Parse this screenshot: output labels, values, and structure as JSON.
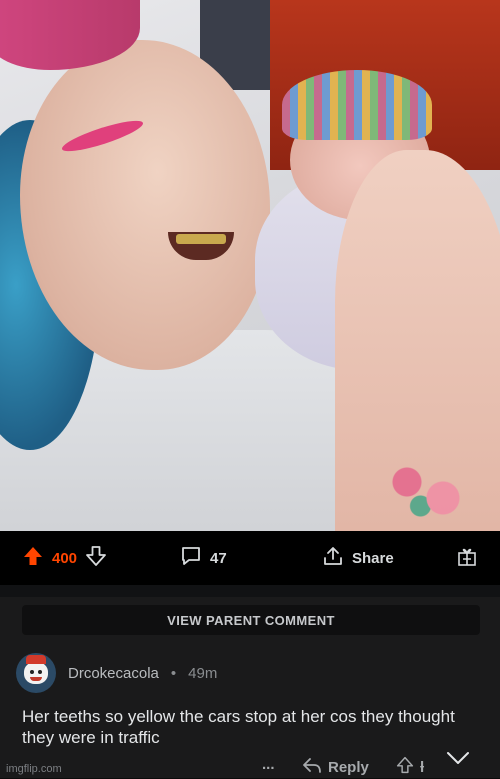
{
  "post": {
    "vote_count": "400",
    "comment_count": "47",
    "share_label": "Share"
  },
  "comment_section": {
    "view_parent_label": "VIEW PARENT COMMENT",
    "comment": {
      "username": "Drcokecacola",
      "separator": "•",
      "time_ago": "49m",
      "text": "Her teeths so yellow the cars stop at her cos they thought they were in traffic",
      "more_label": "...",
      "reply_label": "Reply",
      "vote_partial": "ƚ"
    }
  },
  "watermark": "imgflip.com",
  "colors": {
    "upvote": "#ff4500",
    "background": "#1a1a1b"
  },
  "icons": [
    "upvote-icon",
    "downvote-icon",
    "comment-icon",
    "share-icon",
    "award-icon",
    "reply-icon",
    "chevron-down-icon"
  ]
}
